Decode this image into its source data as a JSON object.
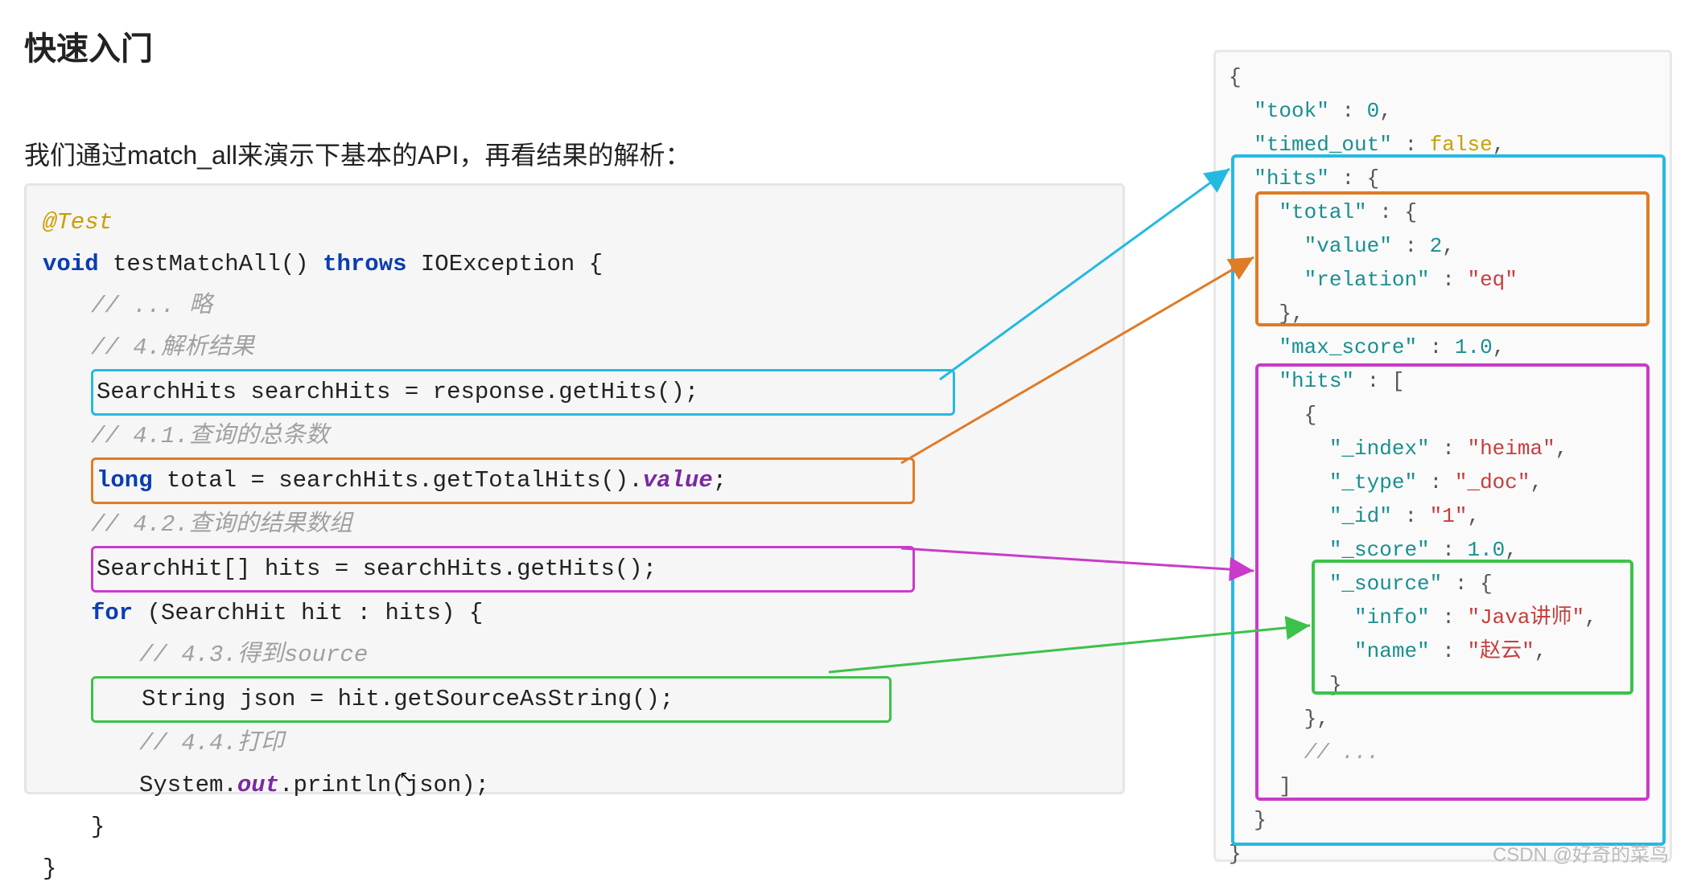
{
  "title": "快速入门",
  "subtitle": "我们通过match_all来演示下基本的API，再看结果的解析：",
  "code": {
    "annotation": "@Test",
    "sig_void": "void",
    "sig_name": " testMatchAll() ",
    "sig_throws": "throws",
    "sig_exc": " IOException {",
    "c_skip": "// ... 略",
    "c4": "// 4.解析结果",
    "line_hits": "SearchHits searchHits = response.getHits();",
    "c41": "// 4.1.查询的总条数",
    "line_total_a": "long",
    "line_total_b": " total = searchHits.getTotalHits().",
    "line_total_c": "value",
    "line_total_d": ";",
    "c42": "// 4.2.查询的结果数组",
    "line_hitsarr": "SearchHit[] hits = searchHits.getHits();",
    "for_kw": "for",
    "for_rest": " (SearchHit hit : hits) {",
    "c43": "// 4.3.得到source",
    "line_src": "String json = hit.getSourceAsString();",
    "c44": "// 4.4.打印",
    "print_a": "System.",
    "print_b": "out",
    "print_c": ".println(json);",
    "brace_close_inner": "}",
    "brace_close_outer": "}"
  },
  "json": {
    "open": "{",
    "took_k": "\"took\"",
    "took_v": "0",
    "timed_k": "\"timed_out\"",
    "timed_v": "false",
    "hits_k": "\"hits\"",
    "total_k": "\"total\"",
    "value_k": "\"value\"",
    "value_v": "2",
    "rel_k": "\"relation\"",
    "rel_v": "\"eq\"",
    "max_k": "\"max_score\"",
    "max_v": "1.0",
    "hits2_k": "\"hits\"",
    "idx_k": "\"_index\"",
    "idx_v": "\"heima\"",
    "type_k": "\"_type\"",
    "type_v": "\"_doc\"",
    "id_k": "\"_id\"",
    "id_v": "\"1\"",
    "score_k": "\"_score\"",
    "score_v": "1.0",
    "src_k": "\"_source\"",
    "info_k": "\"info\"",
    "info_v": "\"Java讲师\"",
    "name_k": "\"name\"",
    "name_v": "\"赵云\"",
    "ellipsis": "// ..."
  },
  "watermark": "CSDN @好奇的菜鸟",
  "colors": {
    "cyan": "#26b9e0",
    "orange": "#e07b26",
    "magenta": "#c93bc9",
    "green": "#3cc24a"
  }
}
